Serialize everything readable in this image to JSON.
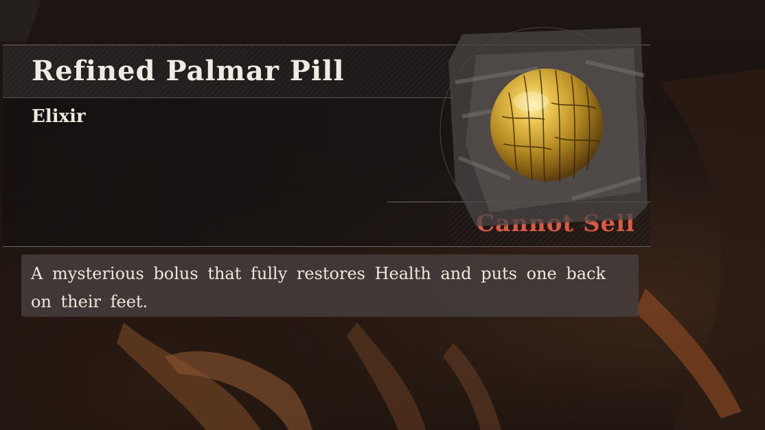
{
  "item": {
    "name": "Refined Palmar Pill",
    "type": "Elixir",
    "sell_status": "Cannot Sell",
    "description": "A mysterious bolus that fully restores Health and puts one back on their feet.",
    "icon": "golden-pill-icon"
  },
  "colors": {
    "title_text": "#f1ece3",
    "sell_status": "#d85a45",
    "description_bg": "#46403e",
    "pill_gold": "#c9a032"
  }
}
